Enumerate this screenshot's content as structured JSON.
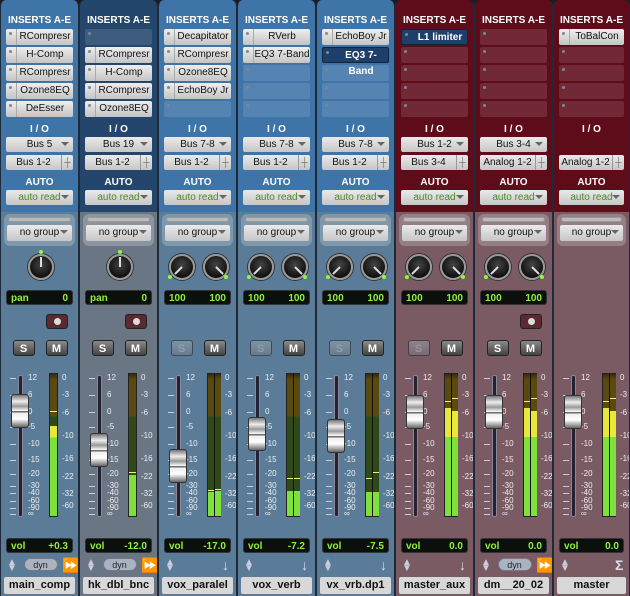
{
  "labels": {
    "inserts": "INSERTS A-E",
    "io": "I / O",
    "auto": "AUTO",
    "vol": "vol",
    "pan": "pan",
    "solo": "S",
    "mute": "M",
    "dyn": "dyn"
  },
  "fader_scale": [
    "12",
    "6",
    "0",
    "-5",
    "-10",
    "-15",
    "-20",
    "-30",
    "-40",
    "-60",
    "-90",
    "∞"
  ],
  "meter_scale": [
    "0",
    "-3",
    "-6",
    "-10",
    "-16",
    "-22",
    "-32",
    "-60"
  ],
  "colors": {
    "blue_track": "#3f74a8",
    "selected_track": "#24466c",
    "master_track": "#5e0c1a",
    "meter_green": "#7ee03a",
    "meter_yellow": "#e8e83a",
    "display_text": "#8ef03a"
  },
  "channels": [
    {
      "name": "main_comp",
      "color": "blue",
      "inserts": [
        {
          "t": "RCompresr"
        },
        {
          "t": "H-Comp"
        },
        {
          "t": "RCompresr"
        },
        {
          "t": "Ozone8EQ"
        },
        {
          "t": "DeEsser"
        }
      ],
      "input": "Bus 5",
      "output": "Bus 1-2",
      "auto": "auto read",
      "group": "no group",
      "pan": {
        "mono": true,
        "value": "0"
      },
      "rec": true,
      "solo_active": true,
      "vol": "+0.3",
      "fader_db": 0.3,
      "meter": {
        "levels": [
          -8
        ],
        "peaks": [
          -5.5
        ]
      },
      "bottom": "dyn"
    },
    {
      "name": "hk_dbl_bnc",
      "color": "dark",
      "inserts": [
        {
          "t": ""
        },
        {
          "t": "RCompresr"
        },
        {
          "t": "H-Comp"
        },
        {
          "t": "RCompresr"
        },
        {
          "t": "Ozone8EQ"
        }
      ],
      "input": "Bus 19",
      "output": "Bus 1-2",
      "auto": "auto read",
      "group": "no group",
      "pan": {
        "mono": true,
        "value": "0"
      },
      "rec": true,
      "solo_active": true,
      "vol": "-12.0",
      "fader_db": -12,
      "meter": {
        "levels": [
          -21
        ],
        "peaks": [
          -20
        ]
      },
      "bottom": "dyn"
    },
    {
      "name": "vox_paralel",
      "color": "blue",
      "inserts": [
        {
          "t": "Decapitator"
        },
        {
          "t": "RCompresr"
        },
        {
          "t": "Ozone8EQ"
        },
        {
          "t": "EchoBoy Jr"
        },
        {
          "t": ""
        }
      ],
      "input": "Bus 7-8",
      "output": "Bus 1-2",
      "auto": "auto read",
      "group": "no group",
      "pan": {
        "mono": false,
        "left": "100",
        "right": "100"
      },
      "rec": false,
      "solo_active": false,
      "vol": "-17.0",
      "fader_db": -17,
      "meter": {
        "levels": [
          -30,
          -29.5
        ],
        "peaks": [
          -29,
          -28.5
        ]
      },
      "bottom": "arrow"
    },
    {
      "name": "vox_verb",
      "color": "blue",
      "inserts": [
        {
          "t": "RVerb"
        },
        {
          "t": "EQ3 7-Band"
        },
        {
          "t": ""
        },
        {
          "t": ""
        },
        {
          "t": ""
        }
      ],
      "input": "Bus 7-8",
      "output": "Bus 1-2",
      "auto": "auto read",
      "group": "no group",
      "pan": {
        "mono": false,
        "left": "100",
        "right": "100"
      },
      "rec": false,
      "solo_active": false,
      "vol": "-7.2",
      "fader_db": -7.2,
      "meter": {
        "levels": [
          -29.5,
          -29.5
        ],
        "peaks": [
          -22,
          -22
        ]
      },
      "bottom": "arrow"
    },
    {
      "name": "vx_vrb.dp1",
      "color": "blue",
      "inserts": [
        {
          "t": "EchoBoy Jr"
        },
        {
          "t": "EQ3 7-Band",
          "active": true
        },
        {
          "t": ""
        },
        {
          "t": ""
        },
        {
          "t": ""
        }
      ],
      "input": "Bus 7-8",
      "output": "Bus 1-2",
      "auto": "auto read",
      "group": "no group",
      "pan": {
        "mono": false,
        "left": "100",
        "right": "100"
      },
      "rec": false,
      "solo_active": false,
      "vol": "-7.5",
      "fader_db": -7.5,
      "meter": {
        "levels": [
          -30,
          -30
        ],
        "peaks": [
          -22,
          -20
        ]
      },
      "bottom": "arrow"
    },
    {
      "name": "master_aux",
      "color": "red",
      "inserts": [
        {
          "t": "L1 limiter",
          "active": true
        },
        {
          "t": ""
        },
        {
          "t": ""
        },
        {
          "t": ""
        },
        {
          "t": ""
        }
      ],
      "input": "Bus 1-2",
      "output": "Bus 3-4",
      "auto": "auto read",
      "group": "no group",
      "pan": {
        "mono": false,
        "left": "100",
        "right": "100"
      },
      "rec": false,
      "solo_active": false,
      "vol": "0.0",
      "fader_db": 0,
      "meter": {
        "levels": [
          -5,
          -5.5
        ],
        "peaks": [
          -3.8,
          -3.3
        ]
      },
      "bottom": "arrow"
    },
    {
      "name": "dm__20_02",
      "color": "red",
      "inserts": [
        {
          "t": ""
        },
        {
          "t": ""
        },
        {
          "t": ""
        },
        {
          "t": ""
        },
        {
          "t": ""
        }
      ],
      "input": "Bus 3-4",
      "output": "Analog 1-2",
      "auto": "auto read",
      "group": "no group",
      "pan": {
        "mono": false,
        "left": "100",
        "right": "100"
      },
      "rec": true,
      "solo_active": true,
      "vol": "0.0",
      "fader_db": 0,
      "meter": {
        "levels": [
          -5,
          -5.5
        ],
        "peaks": [
          -3.8,
          -3.3
        ]
      },
      "bottom": "dyn"
    },
    {
      "name": "master",
      "color": "red",
      "inserts": [
        {
          "t": "ToBalCon"
        },
        {
          "t": ""
        },
        {
          "t": ""
        },
        {
          "t": ""
        },
        {
          "t": ""
        }
      ],
      "input": "",
      "output": "Analog 1-2",
      "auto": "auto read",
      "group": "no group",
      "pan": null,
      "rec": false,
      "solo_active": null,
      "vol": "0.0",
      "fader_db": 0,
      "meter": {
        "levels": [
          -5,
          -5.5
        ],
        "peaks": [
          -3.8,
          -3.3
        ]
      },
      "bottom": "sigma"
    }
  ]
}
